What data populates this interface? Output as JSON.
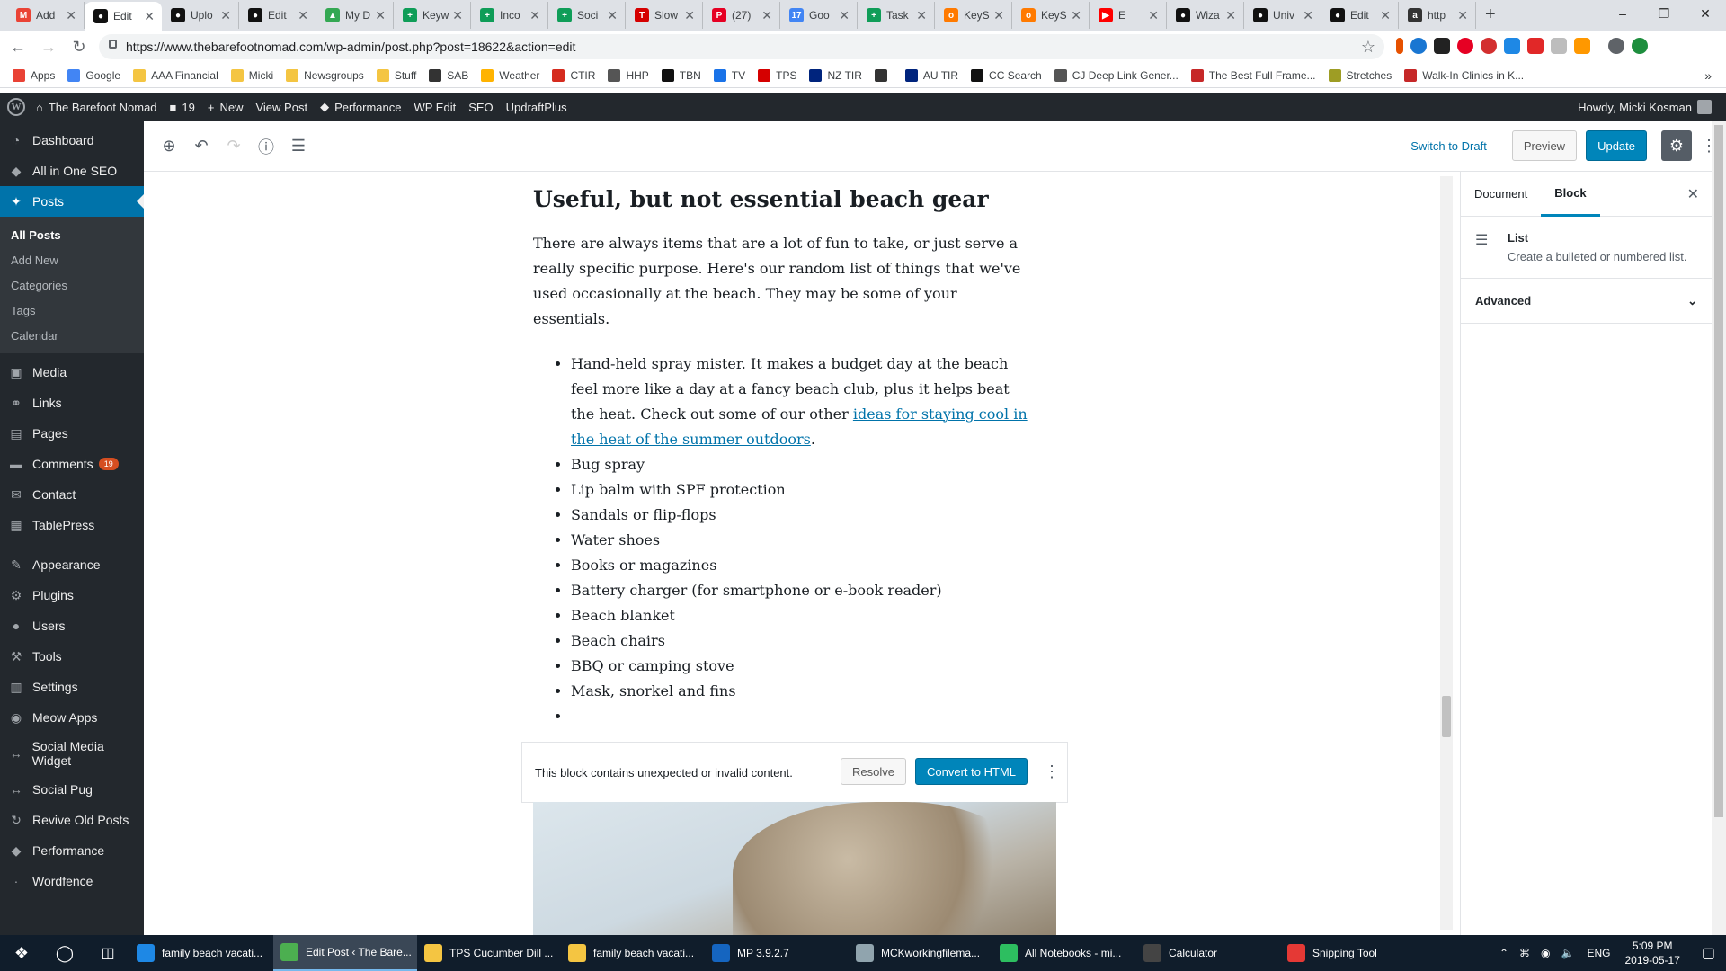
{
  "browser": {
    "tabs": [
      {
        "title": "Add",
        "color": "#ea4335",
        "glyph": "M"
      },
      {
        "title": "Edit",
        "color": "#111111",
        "glyph": "●",
        "active": true
      },
      {
        "title": "Uplo",
        "color": "#111111",
        "glyph": "●"
      },
      {
        "title": "Edit",
        "color": "#111111",
        "glyph": "●"
      },
      {
        "title": "My D",
        "color": "#34a853",
        "glyph": "▲"
      },
      {
        "title": "Keyw",
        "color": "#0f9d58",
        "glyph": "+"
      },
      {
        "title": "Inco",
        "color": "#0f9d58",
        "glyph": "+"
      },
      {
        "title": "Soci",
        "color": "#0f9d58",
        "glyph": "+"
      },
      {
        "title": "Slow",
        "color": "#d50000",
        "glyph": "T"
      },
      {
        "title": "(27)",
        "color": "#e60023",
        "glyph": "P"
      },
      {
        "title": "Goo",
        "color": "#4285f4",
        "glyph": "17"
      },
      {
        "title": "Task",
        "color": "#0f9d58",
        "glyph": "+"
      },
      {
        "title": "KeyS",
        "color": "#ff7a00",
        "glyph": "o"
      },
      {
        "title": "KeyS",
        "color": "#ff7a00",
        "glyph": "o"
      },
      {
        "title": "E",
        "color": "#ff0000",
        "glyph": "▶"
      },
      {
        "title": "Wiza",
        "color": "#111111",
        "glyph": "●"
      },
      {
        "title": "Univ",
        "color": "#111111",
        "glyph": "●"
      },
      {
        "title": "Edit",
        "color": "#111111",
        "glyph": "●"
      },
      {
        "title": "http",
        "color": "#333333",
        "glyph": "a"
      }
    ],
    "new_tab": "+",
    "url": "https://www.thebarefootnomad.com/wp-admin/post.php?post=18622&action=edit",
    "bookmarks": [
      {
        "label": "Apps",
        "color": "#e94235"
      },
      {
        "label": "Google",
        "color": "#4285f4"
      },
      {
        "label": "AAA Financial",
        "color": "#f4c542"
      },
      {
        "label": "Micki",
        "color": "#f4c542"
      },
      {
        "label": "Newsgroups",
        "color": "#f4c542"
      },
      {
        "label": "Stuff",
        "color": "#f4c542"
      },
      {
        "label": "SAB",
        "color": "#333333"
      },
      {
        "label": "Weather",
        "color": "#ffb300"
      },
      {
        "label": "CTIR",
        "color": "#d52b1e"
      },
      {
        "label": "HHP",
        "color": "#555555"
      },
      {
        "label": "TBN",
        "color": "#111111"
      },
      {
        "label": "TV",
        "color": "#1a73e8"
      },
      {
        "label": "TPS",
        "color": "#d50000"
      },
      {
        "label": "NZ TIR",
        "color": "#00247d"
      },
      {
        "label": "",
        "color": "#333333"
      },
      {
        "label": "AU TIR",
        "color": "#00247d"
      },
      {
        "label": "CC Search",
        "color": "#111111"
      },
      {
        "label": "CJ Deep Link Gener...",
        "color": "#555555"
      },
      {
        "label": "The Best Full Frame...",
        "color": "#c62828"
      },
      {
        "label": "Stretches",
        "color": "#9e9d24"
      },
      {
        "label": "Walk-In Clinics in K...",
        "color": "#c62828"
      }
    ]
  },
  "adminbar": {
    "site": "The Barefoot Nomad",
    "comments": "19",
    "new": "New",
    "view_post": "View Post",
    "performance": "Performance",
    "wp_edit": "WP Edit",
    "seo": "SEO",
    "updraft": "UpdraftPlus",
    "howdy": "Howdy, Micki Kosman"
  },
  "menu": {
    "items_top": [
      {
        "label": "Dashboard",
        "icon": "◔"
      },
      {
        "label": "All in One SEO",
        "icon": "◆"
      }
    ],
    "posts": "Posts",
    "posts_sub": [
      {
        "label": "All Posts",
        "current": true
      },
      {
        "label": "Add New"
      },
      {
        "label": "Categories"
      },
      {
        "label": "Tags"
      },
      {
        "label": "Calendar"
      }
    ],
    "items_mid": [
      {
        "label": "Media",
        "icon": "▣"
      },
      {
        "label": "Links",
        "icon": "⚭"
      },
      {
        "label": "Pages",
        "icon": "▤"
      },
      {
        "label": "Comments",
        "icon": "▬",
        "badge": "19"
      },
      {
        "label": "Contact",
        "icon": "✉"
      },
      {
        "label": "TablePress",
        "icon": "▦"
      }
    ],
    "items_bottom": [
      {
        "label": "Appearance",
        "icon": "✎"
      },
      {
        "label": "Plugins",
        "icon": "⚙"
      },
      {
        "label": "Users",
        "icon": "●"
      },
      {
        "label": "Tools",
        "icon": "⚒"
      },
      {
        "label": "Settings",
        "icon": "▥"
      },
      {
        "label": "Meow Apps",
        "icon": "◉"
      },
      {
        "label": "Social Media Widget",
        "icon": "↔"
      },
      {
        "label": "Social Pug",
        "icon": "↔"
      },
      {
        "label": "Revive Old Posts",
        "icon": "↻"
      },
      {
        "label": "Performance",
        "icon": "◆"
      },
      {
        "label": "Wordfence",
        "icon": "·"
      }
    ]
  },
  "editor": {
    "switch_to_draft": "Switch to Draft",
    "preview": "Preview",
    "update": "Update",
    "heading": "Useful, but not essential beach gear",
    "paragraph": "There are always items that are a lot of fun to take, or just serve a really specific purpose. Here's our random list of things that we've used occasionally at the beach. They may be some of your essentials.",
    "first_item_text": "Hand-held spray mister. It makes a budget day at the beach feel more like a day at a fancy beach club, plus it helps beat the heat. Check out some of our other ",
    "first_item_link": "ideas for staying cool in the heat of the summer outdoors",
    "first_item_end": ".",
    "list_items": [
      "Bug spray",
      "Lip balm with SPF protection",
      "Sandals or flip-flops",
      "Water shoes",
      "Books or magazines",
      "Battery charger (for smartphone or e-book reader)",
      "Beach blanket",
      "Beach chairs",
      "BBQ or camping stove",
      "Mask, snorkel and fins",
      ""
    ],
    "warning": "This block contains unexpected or invalid content.",
    "resolve": "Resolve",
    "convert": "Convert to HTML"
  },
  "sidebar": {
    "tab_document": "Document",
    "tab_block": "Block",
    "block_title": "List",
    "block_desc": "Create a bulleted or numbered list.",
    "advanced": "Advanced"
  },
  "taskbar": {
    "items": [
      {
        "label": "family beach vacati...",
        "color": "#1e88e5"
      },
      {
        "label": "Edit Post ‹ The Bare...",
        "color": "#4caf50",
        "active": true
      },
      {
        "label": "TPS Cucumber Dill ...",
        "color": "#f4c542"
      },
      {
        "label": "family beach vacati...",
        "color": "#f4c542"
      },
      {
        "label": "MP 3.9.2.7",
        "color": "#1565c0"
      },
      {
        "label": "MCKworkingfilema...",
        "color": "#90a4ae"
      },
      {
        "label": "All Notebooks - mi...",
        "color": "#2dbe60"
      },
      {
        "label": "Calculator",
        "color": "#444444"
      },
      {
        "label": "Snipping Tool",
        "color": "#e53935"
      }
    ],
    "lang": "ENG",
    "time": "5:09 PM",
    "date": "2019-05-17"
  }
}
